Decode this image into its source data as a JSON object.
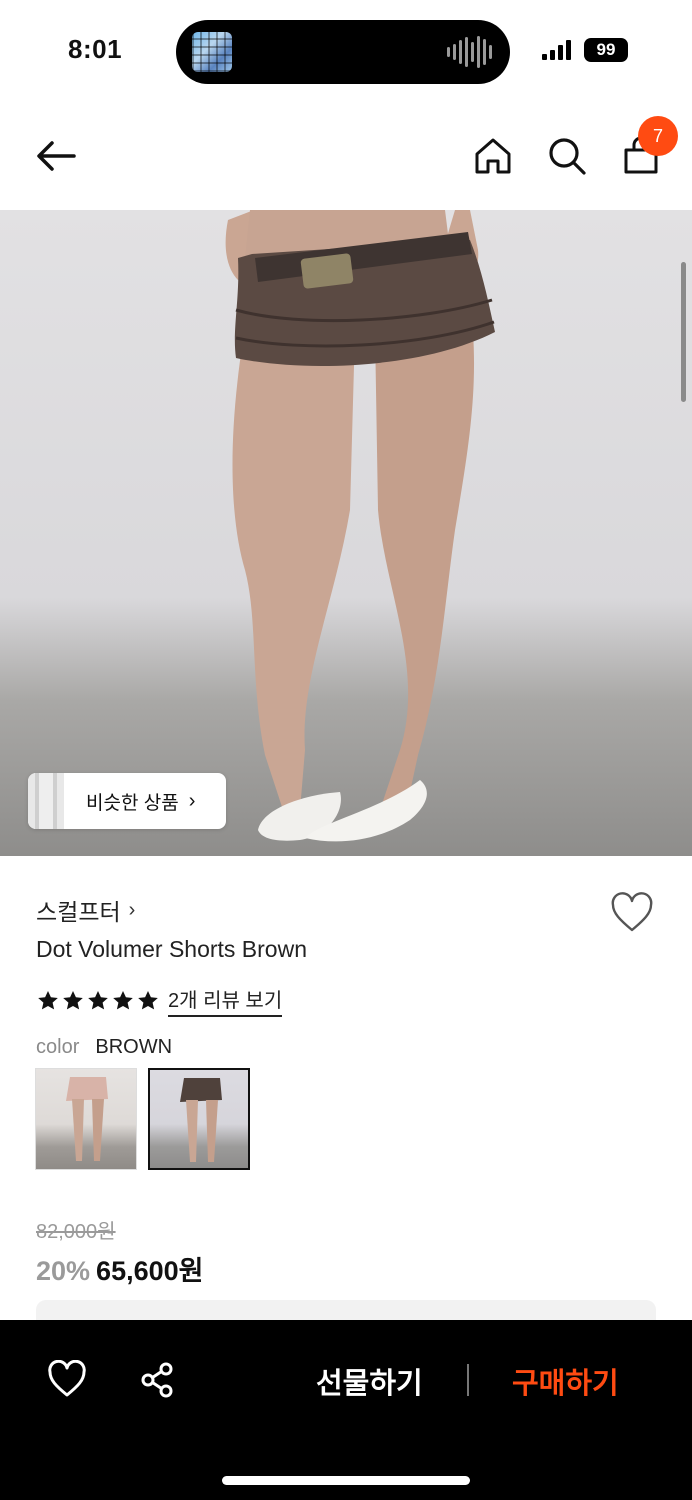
{
  "status_bar": {
    "time": "8:01",
    "battery": "99"
  },
  "header": {
    "cart_count": "7"
  },
  "hero": {
    "similar_button_label": "비슷한 상품"
  },
  "product": {
    "brand": "스컬프터",
    "name": "Dot Volumer Shorts Brown",
    "rating_stars": 5,
    "review_link": "2개 리뷰 보기",
    "color_label": "color",
    "color_value": "BROWN",
    "swatch_selected_index": 1,
    "original_price": "82,000원",
    "discount": "20%",
    "price": "65,600원"
  },
  "bottom_bar": {
    "gift_label": "선물하기",
    "buy_label": "구매하기"
  },
  "colors": {
    "accent": "#ff4b12",
    "bar_bg": "#000000"
  },
  "icons": [
    "back-arrow-icon",
    "home-icon",
    "search-icon",
    "cart-icon",
    "heart-icon",
    "star-icon",
    "share-icon",
    "chevron-right-icon"
  ]
}
